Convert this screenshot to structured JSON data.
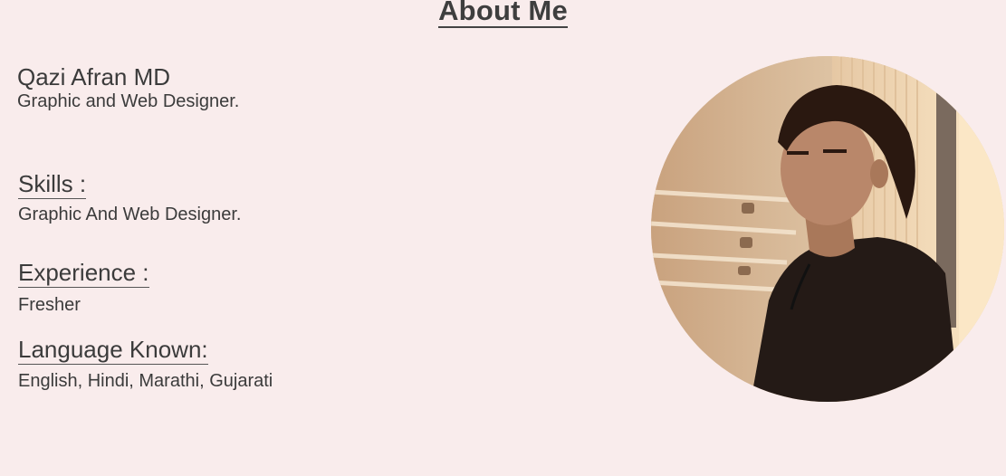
{
  "page": {
    "title": "About Me"
  },
  "profile": {
    "name": "Qazi Afran MD",
    "role": "Graphic and Web Designer."
  },
  "sections": [
    {
      "heading": "Skills :",
      "value": "Graphic And Web Designer."
    },
    {
      "heading": "Experience :",
      "value": "Fresher"
    },
    {
      "heading": "Language Known:",
      "value": "English, Hindi, Marathi, Gujarati"
    }
  ],
  "colors": {
    "background": "#f9ecec",
    "text": "#3e3e3e"
  }
}
